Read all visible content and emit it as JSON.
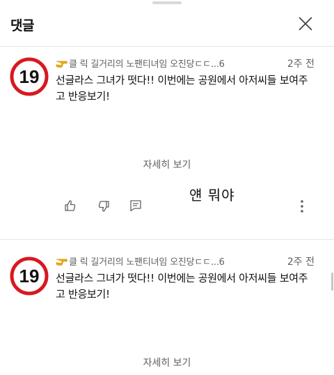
{
  "header": {
    "title": "댓글",
    "close_icon": "close-icon"
  },
  "comments": [
    {
      "avatar_label": "19",
      "author": "클 릭 길거리의 노팬티녀임 오진당ㄷㄷ...6",
      "time": "2주 전",
      "text": "선글라스 그녀가 떳다!! 이번에는 공원에서 아저씨들 보여주고 반응보기!",
      "read_more": "자세히 보기",
      "actions": [
        "like-icon",
        "dislike-icon",
        "reply-icon",
        "more-options-icon"
      ],
      "handwritten_note": "얜 뭐야"
    },
    {
      "avatar_label": "19",
      "author": "클 릭 길거리의 노팬티녀임 오진당ㄷㄷ...6",
      "time": "2주 전",
      "text": "선글라스 그녀가 떳다!! 이번에는 공원에서 아저씨들 보여주고 반응보기!",
      "read_more": "자세히 보기"
    }
  ],
  "colors": {
    "avatar_ring": "#d71920",
    "secondary_text": "#606060",
    "pointer_emoji": "#f4b400"
  }
}
